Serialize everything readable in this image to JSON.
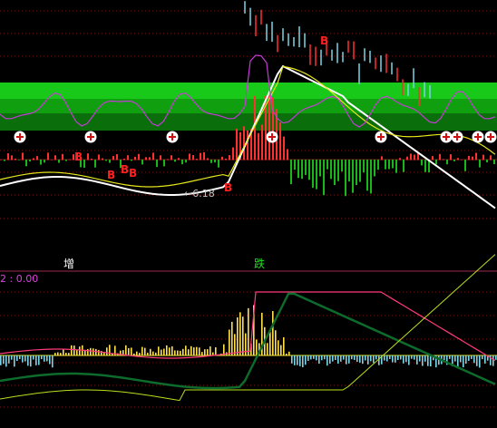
{
  "colors": {
    "background": "#000000",
    "grid": "#7a1010",
    "band_light": "#19c919",
    "band_mid": "#0f9f0f",
    "band_dark": "#0a6e0a",
    "white_line": "#ffffff",
    "yellow_line": "#e6e61a",
    "magenta_line": "#c43bd6",
    "pink_line": "#ff3b7a",
    "dark_green_line": "#0d6b2c",
    "lime_line": "#b8e01c",
    "signal_red": "#ff2020",
    "bar_red": "#ff3030",
    "bar_green": "#18b818",
    "bar_cyan": "#7ad6e6",
    "bar_yellow": "#ffe14d",
    "label_white": "#ffffff",
    "label_green": "#20e020",
    "label_magenta": "#e040e0",
    "label_gray": "#c8c8c8"
  },
  "signals": {
    "buy_marks": [
      "B",
      "B",
      "B",
      "B",
      "B",
      "B"
    ],
    "plus_icon_count": 9
  },
  "annotations": {
    "low_price": "6.18",
    "low_arrow": "←"
  },
  "lower_panel": {
    "indicator_readout": "2 : 0.00",
    "zone_left": "增",
    "zone_right": "跌"
  },
  "chart_data": [
    {
      "type": "line",
      "panel": "price",
      "series": [
        {
          "name": "",
          "color": "#ffffff",
          "values": [
            5.5,
            5.7,
            5.9,
            6.1,
            6.3,
            6.5,
            6.7,
            8.2,
            9.1,
            9.6,
            9.1,
            8.2,
            7.1,
            6.9,
            6.5
          ]
        },
        {
          "name": "",
          "color": "#e6e61a",
          "values": [
            5.8,
            6.0,
            6.2,
            6.3,
            6.4,
            6.6,
            6.9,
            7.8,
            8.8,
            9.1,
            8.7,
            7.8,
            7.0,
            6.8,
            6.6
          ]
        },
        {
          "name": "",
          "color": "#c43bd6",
          "values": [
            7.5,
            7.4,
            7.6,
            7.3,
            7.5,
            7.6,
            7.4,
            9.8,
            8.3,
            7.6,
            7.8,
            8.3,
            7.6,
            7.7,
            7.5
          ]
        }
      ],
      "low_marker": 6.18
    },
    {
      "type": "bar",
      "panel": "oscillator",
      "readout": "2 : 0.00",
      "series": [
        {
          "name": "",
          "color": "#ffe14d",
          "values": [
            0,
            0.5,
            1,
            1,
            0.5,
            1,
            2,
            10,
            6,
            1,
            -1,
            -1.5,
            -1,
            -0.5,
            0
          ]
        }
      ]
    }
  ]
}
